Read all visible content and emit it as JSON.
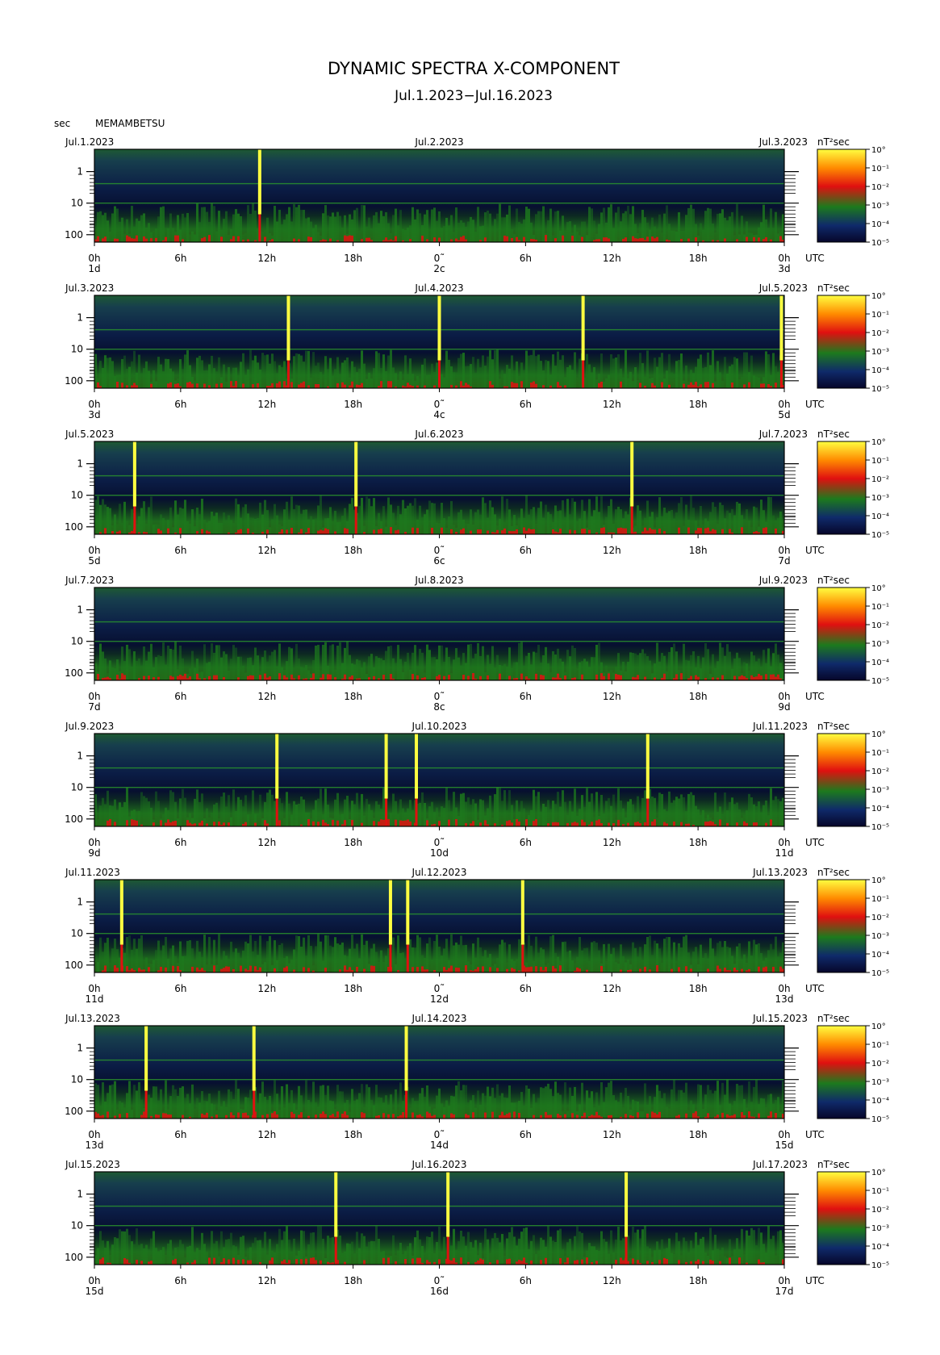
{
  "title": "DYNAMIC SPECTRA X-COMPONENT",
  "subtitle": "Jul.1.2023−Jul.16.2023",
  "y_unit": "sec",
  "station": "MEMAMBETSU",
  "cb_unit": "nT²sec",
  "utc_label": "UTC",
  "chart_data": {
    "type": "heatmap",
    "y_ticks": [
      "1",
      "10",
      "100"
    ],
    "x_ticks": [
      "0h",
      "6h",
      "12h",
      "18h",
      "0˜",
      "6h",
      "12h",
      "18h",
      "0h"
    ],
    "colorbar_ticks": [
      "10°",
      "10⁻¹",
      "10⁻²",
      "10⁻³",
      "10⁻⁴",
      "10⁻⁵"
    ],
    "colormap": [
      "#06062a",
      "#0f2a6a",
      "#1d7a1d",
      "#e01010",
      "#ff8c00",
      "#ffff40"
    ],
    "panels": [
      {
        "left": "Jul.1.2023",
        "center": "Jul.2.2023",
        "right": "Jul.3.2023",
        "d0": "1d",
        "d1": "2c",
        "d2": "3d",
        "spikes_h": [
          11.5
        ]
      },
      {
        "left": "Jul.3.2023",
        "center": "Jul.4.2023",
        "right": "Jul.5.2023",
        "d0": "3d",
        "d1": "4c",
        "d2": "5d",
        "spikes_h": [
          13.5,
          24.0,
          34.0,
          47.8
        ]
      },
      {
        "left": "Jul.5.2023",
        "center": "Jul.6.2023",
        "right": "Jul.7.2023",
        "d0": "5d",
        "d1": "6c",
        "d2": "7d",
        "spikes_h": [
          2.8,
          18.2,
          37.4
        ]
      },
      {
        "left": "Jul.7.2023",
        "center": "Jul.8.2023",
        "right": "Jul.9.2023",
        "d0": "7d",
        "d1": "8c",
        "d2": "9d",
        "spikes_h": []
      },
      {
        "left": "Jul.9.2023",
        "center": "Jul.10.2023",
        "right": "Jul.11.2023",
        "d0": "9d",
        "d1": "10d",
        "d2": "11d",
        "spikes_h": [
          12.7,
          20.3,
          22.4,
          38.5
        ]
      },
      {
        "left": "Jul.11.2023",
        "center": "Jul.12.2023",
        "right": "Jul.13.2023",
        "d0": "11d",
        "d1": "12d",
        "d2": "13d",
        "spikes_h": [
          1.9,
          20.6,
          21.8,
          29.8
        ]
      },
      {
        "left": "Jul.13.2023",
        "center": "Jul.14.2023",
        "right": "Jul.15.2023",
        "d0": "13d",
        "d1": "14d",
        "d2": "15d",
        "spikes_h": [
          3.6,
          11.1,
          21.7
        ]
      },
      {
        "left": "Jul.15.2023",
        "center": "Jul.16.2023",
        "right": "Jul.17.2023",
        "d0": "15d",
        "d1": "16d",
        "d2": "17d",
        "spikes_h": [
          16.8,
          24.6,
          37.0
        ]
      }
    ]
  }
}
